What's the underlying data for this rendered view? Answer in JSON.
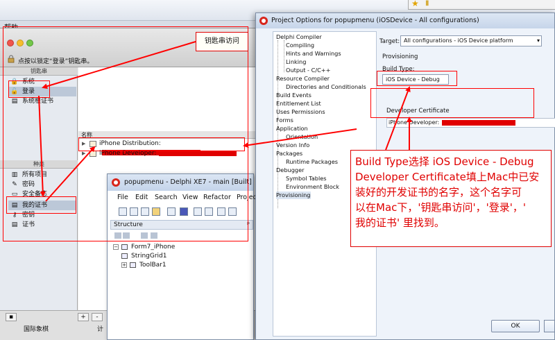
{
  "desktop": {
    "help_menu": "帮助"
  },
  "keychain": {
    "lock_hint": "点按以锁定“登录”钥匙串。",
    "tag_label": "钥匙串访问",
    "keychains_header": "钥匙串",
    "keychains": [
      {
        "label": "系统",
        "icon": "lock-icon"
      },
      {
        "label": "登录",
        "icon": "lock-icon"
      },
      {
        "label": "系统根证书",
        "icon": "cert-icon"
      }
    ],
    "category_header": "种类",
    "categories": [
      {
        "label": "所有项目",
        "icon": "all-items-icon"
      },
      {
        "label": "密码",
        "icon": "pencil-icon"
      },
      {
        "label": "安全备忘",
        "icon": "note-icon"
      },
      {
        "label": "我的证书",
        "icon": "cert-icon"
      },
      {
        "label": "密钥",
        "icon": "key-icon"
      },
      {
        "label": "证书",
        "icon": "cert-icon"
      }
    ],
    "column_name": "名称",
    "certs": [
      {
        "label": "iPhone Distribution:"
      },
      {
        "label": "iPhone Developer:"
      }
    ],
    "footer_left": "国际象棋",
    "footer_right": "计"
  },
  "delphi": {
    "title": "popupmenu - Delphi XE7 - main [Built]",
    "menu": [
      "File",
      "Edit",
      "Search",
      "View",
      "Refactor",
      "Projec"
    ],
    "structure_title": "Structure",
    "structure_pin": "ᵖ",
    "tree": [
      "Form7_iPhone",
      "StringGrid1",
      "ToolBar1"
    ]
  },
  "dialog": {
    "title": "Project Options for popupmenu  (iOSDevice - All configurations)",
    "tree": [
      "Delphi Compiler",
      "Compiling",
      "Hints and Warnings",
      "Linking",
      "Output - C/C++",
      "Resource Compiler",
      "Directories and Conditionals",
      "Build Events",
      "Entitlement List",
      "Uses Permissions",
      "Forms",
      "Application",
      "Orientation",
      "Version Info",
      "Packages",
      "Runtime Packages",
      "Debugger",
      "Symbol Tables",
      "Environment Block",
      "Provisioning"
    ],
    "target_label": "Target:",
    "target_value": "All configurations - iOS Device platform",
    "provisioning_header": "Provisioning",
    "build_type_label": "Build Type:",
    "build_type_value": "iOS Device - Debug",
    "dev_cert_label": "Developer Certificate",
    "dev_cert_value": "iPhone Developer:",
    "ok_label": "OK"
  },
  "callout": {
    "lines": [
      "Build Type选择 iOS Device - Debug",
      "Developer Certificate填上Mac中已安",
      "装好的开发证书的名字，这个名字可",
      "以在Mac下，'钥匙串访问'，'登录'，'",
      "我的证书' 里找到。"
    ]
  },
  "colors": {
    "annotation": "#e00000",
    "selection": "#bcc8d8",
    "delphi_logo": "#d8261c"
  }
}
